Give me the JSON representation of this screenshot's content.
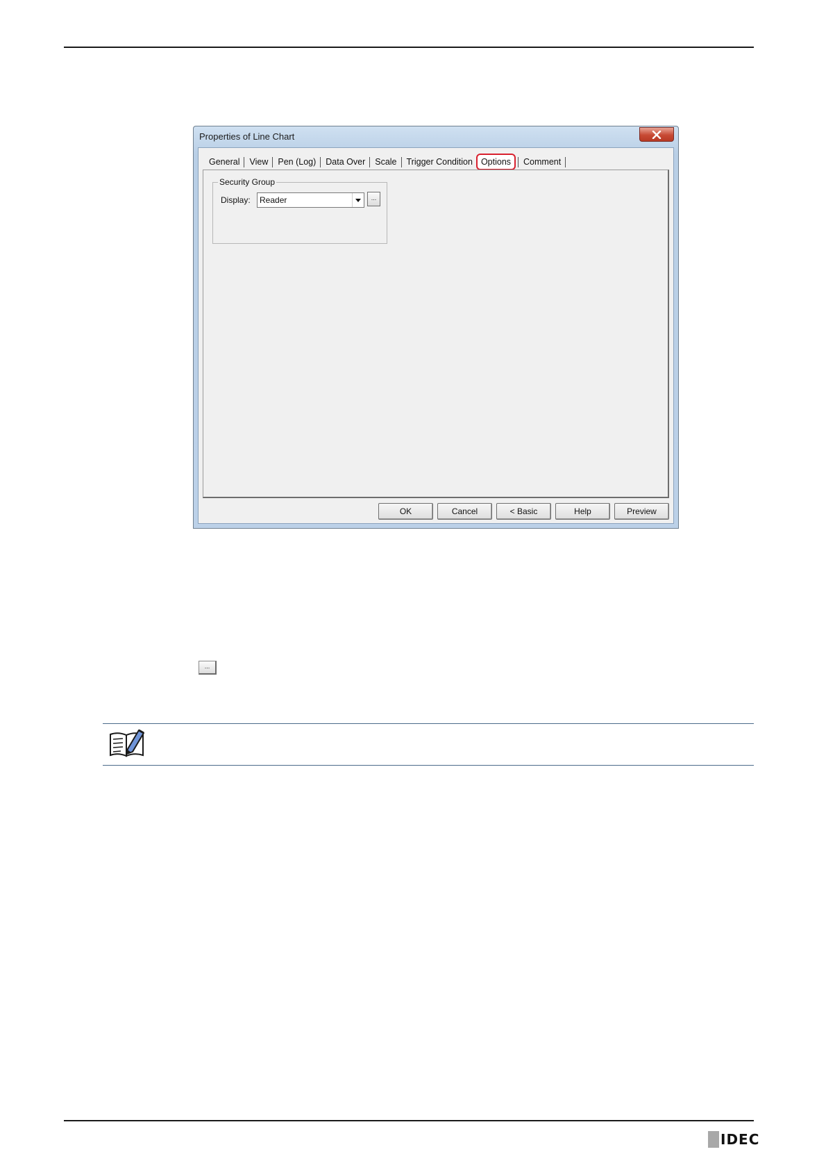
{
  "dialog": {
    "title": "Properties of Line Chart",
    "tabs": [
      {
        "label": "General"
      },
      {
        "label": "View"
      },
      {
        "label": "Pen (Log)"
      },
      {
        "label": "Data Over"
      },
      {
        "label": "Scale"
      },
      {
        "label": "Trigger Condition"
      },
      {
        "label": "Options",
        "active": true
      },
      {
        "label": "Comment"
      }
    ],
    "security_group": {
      "legend": "Security Group",
      "display_label": "Display:",
      "display_value": "Reader",
      "browse_label": "..."
    },
    "buttons": {
      "ok": "OK",
      "cancel": "Cancel",
      "basic": "< Basic",
      "help": "Help",
      "preview": "Preview"
    }
  },
  "inline_button_label": "...",
  "logo": {
    "text": "IDEC"
  },
  "colors": {
    "highlight": "#d8202e",
    "close_button": "#c74a34",
    "note_rule": "#4a6a8a"
  }
}
